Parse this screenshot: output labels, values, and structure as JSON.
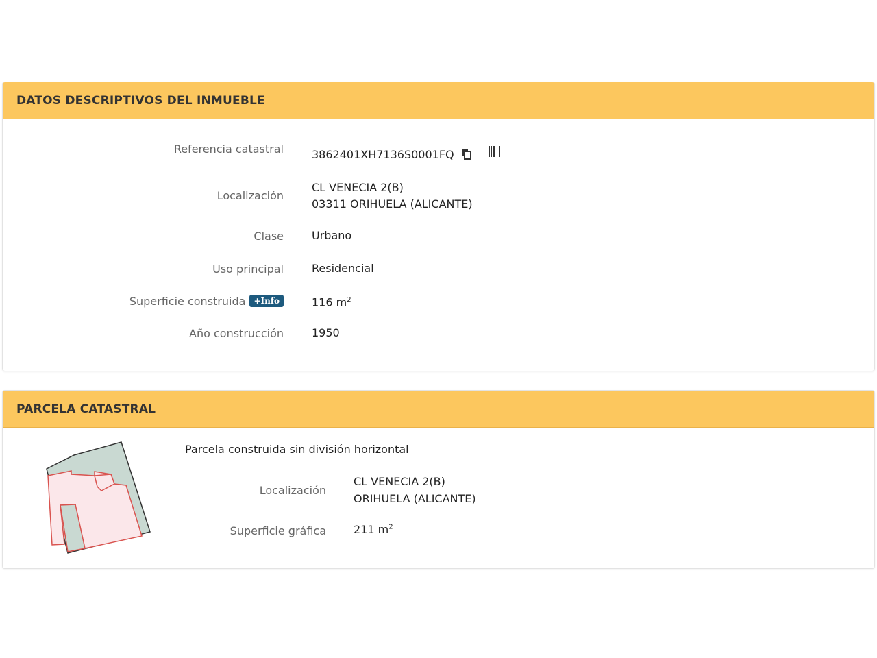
{
  "inmueble": {
    "title": "DATOS DESCRIPTIVOS DEL INMUEBLE",
    "referencia": {
      "label": "Referencia catastral",
      "value": "3862401XH7136S0001FQ"
    },
    "localizacion": {
      "label": "Localización",
      "line1": "CL VENECIA 2(B)",
      "line2": "03311 ORIHUELA (ALICANTE)"
    },
    "clase": {
      "label": "Clase",
      "value": "Urbano"
    },
    "uso": {
      "label": "Uso principal",
      "value": "Residencial"
    },
    "superficie": {
      "label": "Superficie construida",
      "info_label": "+Info",
      "value": "116 m",
      "unit_sup": "2"
    },
    "anio": {
      "label": "Año construcción",
      "value": "1950"
    }
  },
  "parcela": {
    "title": "PARCELA CATASTRAL",
    "description": "Parcela construida sin división horizontal",
    "localizacion": {
      "label": "Localización",
      "line1": "CL VENECIA 2(B)",
      "line2": "ORIHUELA (ALICANTE)"
    },
    "superficie": {
      "label": "Superficie gráfica",
      "value": "211 m",
      "unit_sup": "2"
    }
  },
  "colors": {
    "header_bg": "#fcc75e",
    "badge_bg": "#1d5a7e",
    "parcel_fill": "#c9d9d2",
    "building_fill": "#fbe7ea",
    "building_stroke": "#d9534f"
  }
}
